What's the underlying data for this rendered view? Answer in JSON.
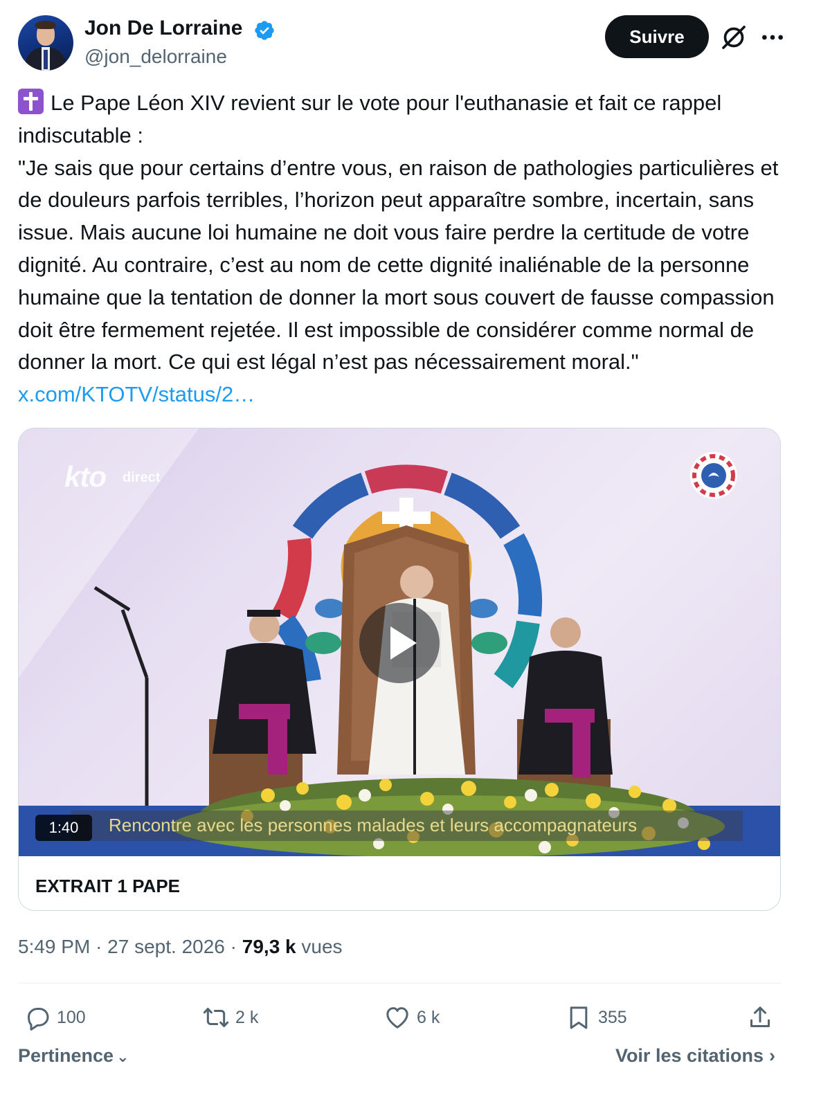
{
  "author": {
    "display_name": "Jon De Lorraine",
    "handle": "@jon_delorraine",
    "verified": true
  },
  "header": {
    "follow_label": "Suivre",
    "grok_icon": "grok-icon",
    "more_icon": "more-icon"
  },
  "tweet": {
    "emoji": "latin-cross-emoji",
    "intro": "Le Pape Léon XIV revient sur le vote pour l'euthanasie et fait ce rappel indiscutable :",
    "quote": "\"Je sais que pour certains d’entre vous, en raison de pathologies particulières et de douleurs parfois terribles, l’horizon peut apparaître sombre, incertain, sans issue. Mais aucune loi humaine ne doit vous faire perdre la certitude de votre dignité. Au contraire, c’est au nom de cette dignité inaliénable de la personne humaine que la tentation de donner la mort sous couvert de fausse compassion doit être fermement rejetée. Il est impossible de considérer comme normal de donner la mort. Ce qui est légal n’est pas nécessairement moral.\"",
    "link": "x.com/KTOTV/status/2…"
  },
  "media": {
    "channel_logo": "kto",
    "channel_status": "direct",
    "duration": "1:40",
    "subtitle": "Rencontre avec les personnes malades et leurs accompagnateurs",
    "card_title": "EXTRAIT 1 PAPE"
  },
  "meta": {
    "time": "5:49 PM",
    "date": "27 sept. 2026",
    "views_count": "79,3 k",
    "views_label": "vues",
    "separator": "·"
  },
  "actions": {
    "replies": "100",
    "reposts": "2 k",
    "likes": "6 k",
    "bookmarks": "355"
  },
  "footer": {
    "sort_label": "Pertinence",
    "quotes_label": "Voir les citations"
  },
  "colors": {
    "text": "#0f1419",
    "secondary": "#536471",
    "link": "#1d9bf0",
    "verified": "#1d9bf0",
    "follow_bg": "#0f1419"
  }
}
